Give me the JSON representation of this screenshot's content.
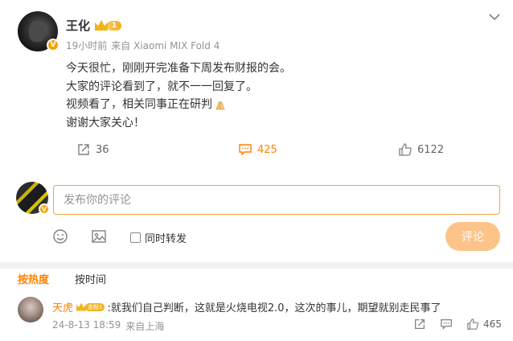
{
  "post": {
    "author": "王化",
    "vip_level": "1",
    "verified_mark": "V",
    "time": "19小时前",
    "source": "来自 Xiaomi MIX Fold 4",
    "lines": [
      "今天很忙，刚刚开完准备下周发布财报的会。",
      "大家的评论看到了，就不一一回复了。",
      "视频看了，相关同事正在研判",
      "谢谢大家关心！"
    ],
    "emoji": "praying-hands-emoji",
    "repost_count": "36",
    "comment_count": "425",
    "like_count": "6122"
  },
  "composer": {
    "placeholder": "发布你的评论",
    "repost_label": "同时转发",
    "submit_label": "评论",
    "verified_mark": "V"
  },
  "sort": {
    "hot_label": "按热度",
    "time_label": "按时间"
  },
  "comments": [
    {
      "user": "天虎",
      "badge": "金粉1",
      "text": ":就我们自己判断，这就是火烧电视2.0，这次的事儿，期望就别走民事了",
      "date": "24-8-13 18:59",
      "location": "来自上海",
      "like_count": "465"
    }
  ],
  "colors": {
    "accent": "#ff8200",
    "submit_disabled": "#fdc48a",
    "meta": "#939393"
  },
  "icons": {
    "more": "chevron-down-icon",
    "repost": "share-icon",
    "comment": "comment-bubble-icon",
    "like": "thumbs-up-icon",
    "emoji": "smiley-icon",
    "image": "image-icon"
  }
}
